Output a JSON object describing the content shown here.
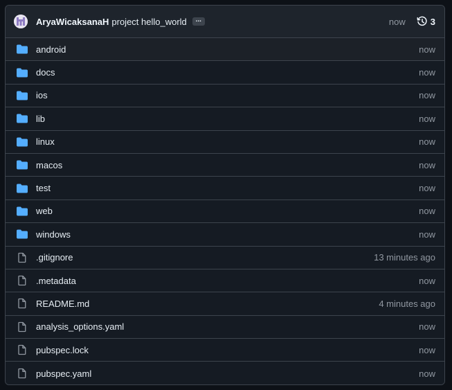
{
  "commit": {
    "author": "AryaWicaksanaH",
    "message": "project hello_world",
    "ellipsis": "...",
    "time": "now",
    "history_count": "3"
  },
  "colors": {
    "folder": "#54aeff",
    "file": "#9198a1"
  },
  "files": [
    {
      "name": "android",
      "type": "folder",
      "time": "now"
    },
    {
      "name": "docs",
      "type": "folder",
      "time": "now"
    },
    {
      "name": "ios",
      "type": "folder",
      "time": "now"
    },
    {
      "name": "lib",
      "type": "folder",
      "time": "now"
    },
    {
      "name": "linux",
      "type": "folder",
      "time": "now"
    },
    {
      "name": "macos",
      "type": "folder",
      "time": "now"
    },
    {
      "name": "test",
      "type": "folder",
      "time": "now"
    },
    {
      "name": "web",
      "type": "folder",
      "time": "now"
    },
    {
      "name": "windows",
      "type": "folder",
      "time": "now"
    },
    {
      "name": ".gitignore",
      "type": "file",
      "time": "13 minutes ago"
    },
    {
      "name": ".metadata",
      "type": "file",
      "time": "now"
    },
    {
      "name": "README.md",
      "type": "file",
      "time": "4 minutes ago"
    },
    {
      "name": "analysis_options.yaml",
      "type": "file",
      "time": "now"
    },
    {
      "name": "pubspec.lock",
      "type": "file",
      "time": "now"
    },
    {
      "name": "pubspec.yaml",
      "type": "file",
      "time": "now"
    }
  ]
}
